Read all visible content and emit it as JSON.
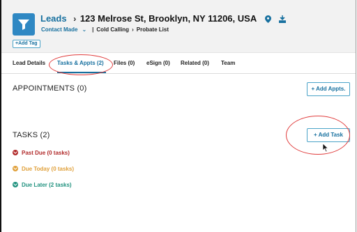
{
  "header": {
    "breadcrumb_root": "Leads",
    "address": "123 Melrose St, Brooklyn, NY 11206, USA",
    "status": "Contact Made",
    "campaign": "Cold Calling",
    "list_name": "Probate List",
    "add_tag_label": "+Add Tag"
  },
  "tabs": [
    {
      "label": "Lead Details"
    },
    {
      "label": "Tasks & Appts (2)"
    },
    {
      "label": "Files (0)"
    },
    {
      "label": "eSign (0)"
    },
    {
      "label": "Related (0)"
    },
    {
      "label": "Team"
    }
  ],
  "appointments": {
    "title": "APPOINTMENTS (0)",
    "add_label": "+ Add Appts."
  },
  "tasks": {
    "title": "TASKS (2)",
    "add_label": "+ Add Task",
    "groups": [
      {
        "label": "Past Due (0 tasks)",
        "color": "#b12a2a"
      },
      {
        "label": "Due Today (0 tasks)",
        "color": "#e0a03a"
      },
      {
        "label": "Due Later (2 tasks)",
        "color": "#21927f"
      }
    ]
  },
  "colors": {
    "accent": "#17709f",
    "brand_icon": "#2f88c3",
    "highlight": "#e03b3b"
  }
}
